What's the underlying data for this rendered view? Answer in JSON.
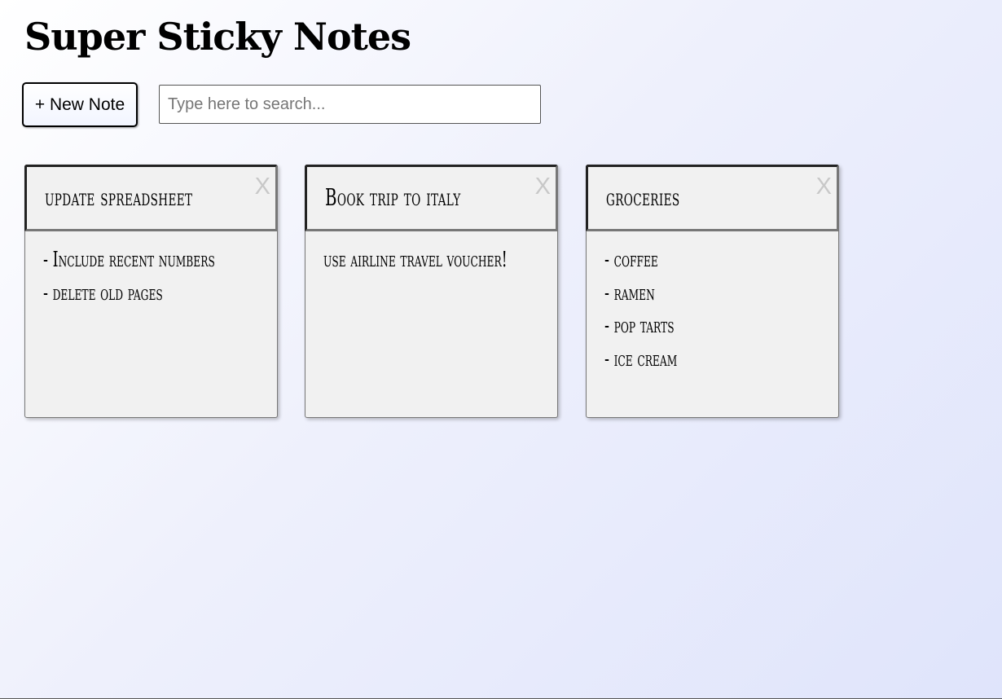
{
  "app": {
    "title": "Super Sticky Notes"
  },
  "toolbar": {
    "new_note_label": "+ New Note",
    "search_placeholder": "Type here to search...",
    "search_value": ""
  },
  "notes": [
    {
      "title": "update spreadsheet",
      "close_label": "X",
      "lines": [
        "- Include recent numbers",
        "- delete old pages"
      ]
    },
    {
      "title": "Book trip to italy",
      "close_label": "X",
      "lines": [
        "use airline travel voucher!"
      ]
    },
    {
      "title": "groceries",
      "close_label": "X",
      "lines": [
        "- coffee",
        "- ramen",
        "- pop tarts",
        "- ice cream"
      ]
    }
  ]
}
